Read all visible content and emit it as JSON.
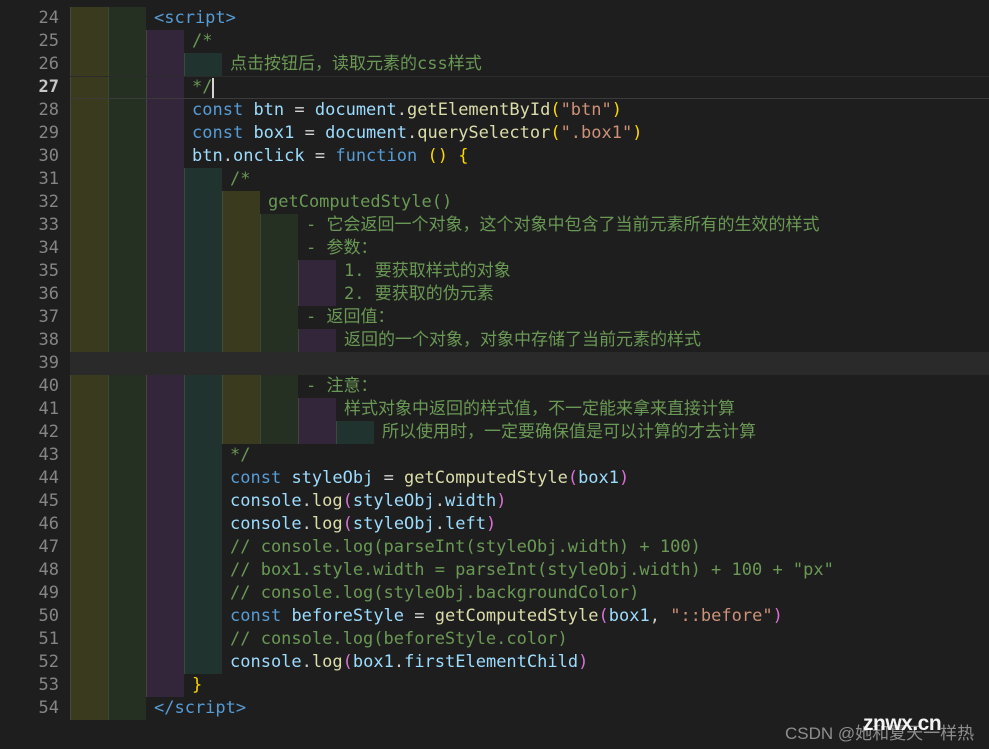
{
  "editor": {
    "first_line": 24,
    "line_height": 23,
    "indent_width": 38,
    "active_line": 27,
    "selected_line": 39,
    "theme": {
      "background": "#1e1e1e",
      "gutter_text": "#858585",
      "gutter_active_text": "#c6c6c6",
      "keyword": "#569cd6",
      "variable": "#9cdcfe",
      "function": "#dcdcaa",
      "string": "#ce9178",
      "number": "#b5cea8",
      "comment": "#6a9955",
      "operator": "#d4d4d4",
      "bracket_yellow": "#ffd700",
      "bracket_magenta": "#da70d6",
      "bracket_blue": "#179fff",
      "indent_olive": "#3a3a1e",
      "indent_green": "#253023",
      "indent_purple": "#33253a",
      "indent_teal": "#21332f"
    }
  },
  "lines": [
    {
      "n": 24,
      "indents": 2,
      "text": "<script>"
    },
    {
      "n": 25,
      "indents": 3,
      "text": "/*"
    },
    {
      "n": 26,
      "indents": 4,
      "text": "点击按钮后，读取元素的css样式"
    },
    {
      "n": 27,
      "indents": 3,
      "text": "*/"
    },
    {
      "n": 28,
      "indents": 3,
      "text": "const btn = document.getElementById(\"btn\")"
    },
    {
      "n": 29,
      "indents": 3,
      "text": "const box1 = document.querySelector(\".box1\")"
    },
    {
      "n": 30,
      "indents": 3,
      "text": "btn.onclick = function () {"
    },
    {
      "n": 31,
      "indents": 4,
      "text": "/*"
    },
    {
      "n": 32,
      "indents": 5,
      "text": "getComputedStyle()"
    },
    {
      "n": 33,
      "indents": 6,
      "text": "- 它会返回一个对象，这个对象中包含了当前元素所有的生效的样式"
    },
    {
      "n": 34,
      "indents": 6,
      "text": "- 参数："
    },
    {
      "n": 35,
      "indents": 7,
      "text": "1. 要获取样式的对象"
    },
    {
      "n": 36,
      "indents": 7,
      "text": "2. 要获取的伪元素"
    },
    {
      "n": 37,
      "indents": 6,
      "text": "- 返回值："
    },
    {
      "n": 38,
      "indents": 7,
      "text": "返回的一个对象，对象中存储了当前元素的样式"
    },
    {
      "n": 39,
      "indents": 0,
      "text": ""
    },
    {
      "n": 40,
      "indents": 6,
      "text": "- 注意："
    },
    {
      "n": 41,
      "indents": 7,
      "text": "样式对象中返回的样式值，不一定能来拿来直接计算"
    },
    {
      "n": 42,
      "indents": 8,
      "text": "所以使用时，一定要确保值是可以计算的才去计算"
    },
    {
      "n": 43,
      "indents": 4,
      "text": "*/"
    },
    {
      "n": 44,
      "indents": 4,
      "text": "const styleObj = getComputedStyle(box1)"
    },
    {
      "n": 45,
      "indents": 4,
      "text": "console.log(styleObj.width)"
    },
    {
      "n": 46,
      "indents": 4,
      "text": "console.log(styleObj.left)"
    },
    {
      "n": 47,
      "indents": 4,
      "text": "// console.log(parseInt(styleObj.width) + 100)"
    },
    {
      "n": 48,
      "indents": 4,
      "text": "// box1.style.width = parseInt(styleObj.width) + 100 + \"px\""
    },
    {
      "n": 49,
      "indents": 4,
      "text": "// console.log(styleObj.backgroundColor)"
    },
    {
      "n": 50,
      "indents": 4,
      "text": "const beforeStyle = getComputedStyle(box1, \"::before\")"
    },
    {
      "n": 51,
      "indents": 4,
      "text": "// console.log(beforeStyle.color)"
    },
    {
      "n": 52,
      "indents": 4,
      "text": "console.log(box1.firstElementChild)"
    },
    {
      "n": 53,
      "indents": 3,
      "text": "}"
    },
    {
      "n": 54,
      "indents": 2,
      "text": "</script>"
    }
  ],
  "tokens": {
    "24": [
      [
        "tag",
        "<script>"
      ]
    ],
    "25": [
      [
        "cmt",
        "/*"
      ]
    ],
    "26": [
      [
        "cmt",
        "点击按钮后，读取元素的css样式"
      ]
    ],
    "27": [
      [
        "cmt",
        "*/"
      ]
    ],
    "28": [
      [
        "kw",
        "const"
      ],
      [
        "op",
        " "
      ],
      [
        "var",
        "btn"
      ],
      [
        "op",
        " = "
      ],
      [
        "var",
        "document"
      ],
      [
        "punc",
        "."
      ],
      [
        "fn",
        "getElementById"
      ],
      [
        "p0",
        "("
      ],
      [
        "str",
        "\"btn\""
      ],
      [
        "p0",
        ")"
      ]
    ],
    "29": [
      [
        "kw",
        "const"
      ],
      [
        "op",
        " "
      ],
      [
        "var",
        "box1"
      ],
      [
        "op",
        " = "
      ],
      [
        "var",
        "document"
      ],
      [
        "punc",
        "."
      ],
      [
        "fn",
        "querySelector"
      ],
      [
        "p0",
        "("
      ],
      [
        "str",
        "\".box1\""
      ],
      [
        "p0",
        ")"
      ]
    ],
    "30": [
      [
        "var",
        "btn"
      ],
      [
        "punc",
        "."
      ],
      [
        "var",
        "onclick"
      ],
      [
        "op",
        " = "
      ],
      [
        "kw",
        "function"
      ],
      [
        "op",
        " "
      ],
      [
        "p0",
        "()"
      ],
      [
        "op",
        " "
      ],
      [
        "p0",
        "{"
      ]
    ],
    "31": [
      [
        "cmt",
        "/*"
      ]
    ],
    "32": [
      [
        "cmt",
        "getComputedStyle()"
      ]
    ],
    "33": [
      [
        "cmt",
        "- 它会返回一个对象，这个对象中包含了当前元素所有的生效的样式"
      ]
    ],
    "34": [
      [
        "cmt",
        "- 参数："
      ]
    ],
    "35": [
      [
        "cmt",
        "1. 要获取样式的对象"
      ]
    ],
    "36": [
      [
        "cmt",
        "2. 要获取的伪元素"
      ]
    ],
    "37": [
      [
        "cmt",
        "- 返回值："
      ]
    ],
    "38": [
      [
        "cmt",
        "返回的一个对象，对象中存储了当前元素的样式"
      ]
    ],
    "39": [],
    "40": [
      [
        "cmt",
        "- 注意："
      ]
    ],
    "41": [
      [
        "cmt",
        "样式对象中返回的样式值，不一定能来拿来直接计算"
      ]
    ],
    "42": [
      [
        "cmt",
        "所以使用时，一定要确保值是可以计算的才去计算"
      ]
    ],
    "43": [
      [
        "cmt",
        "*/"
      ]
    ],
    "44": [
      [
        "kw",
        "const"
      ],
      [
        "op",
        " "
      ],
      [
        "var",
        "styleObj"
      ],
      [
        "op",
        " = "
      ],
      [
        "fn",
        "getComputedStyle"
      ],
      [
        "p1",
        "("
      ],
      [
        "var",
        "box1"
      ],
      [
        "p1",
        ")"
      ]
    ],
    "45": [
      [
        "var",
        "console"
      ],
      [
        "punc",
        "."
      ],
      [
        "fn",
        "log"
      ],
      [
        "p1",
        "("
      ],
      [
        "var",
        "styleObj"
      ],
      [
        "punc",
        "."
      ],
      [
        "var",
        "width"
      ],
      [
        "p1",
        ")"
      ]
    ],
    "46": [
      [
        "var",
        "console"
      ],
      [
        "punc",
        "."
      ],
      [
        "fn",
        "log"
      ],
      [
        "p1",
        "("
      ],
      [
        "var",
        "styleObj"
      ],
      [
        "punc",
        "."
      ],
      [
        "var",
        "left"
      ],
      [
        "p1",
        ")"
      ]
    ],
    "47": [
      [
        "cmt",
        "// console.log(parseInt(styleObj.width) + 100)"
      ]
    ],
    "48": [
      [
        "cmt",
        "// box1.style.width = parseInt(styleObj.width) + 100 + \"px\""
      ]
    ],
    "49": [
      [
        "cmt",
        "// console.log(styleObj.backgroundColor)"
      ]
    ],
    "50": [
      [
        "kw",
        "const"
      ],
      [
        "op",
        " "
      ],
      [
        "var",
        "beforeStyle"
      ],
      [
        "op",
        " = "
      ],
      [
        "fn",
        "getComputedStyle"
      ],
      [
        "p1",
        "("
      ],
      [
        "var",
        "box1"
      ],
      [
        "punc",
        ", "
      ],
      [
        "str",
        "\"::before\""
      ],
      [
        "p1",
        ")"
      ]
    ],
    "51": [
      [
        "cmt",
        "// console.log(beforeStyle.color)"
      ]
    ],
    "52": [
      [
        "var",
        "console"
      ],
      [
        "punc",
        "."
      ],
      [
        "fn",
        "log"
      ],
      [
        "p1",
        "("
      ],
      [
        "var",
        "box1"
      ],
      [
        "punc",
        "."
      ],
      [
        "var",
        "firstElementChild"
      ],
      [
        "p1",
        ")"
      ]
    ],
    "53": [
      [
        "p0",
        "}"
      ]
    ],
    "54": [
      [
        "tag",
        "</script>"
      ]
    ]
  },
  "watermark": {
    "credit": "CSDN @她和夏天一样热",
    "overlay": "znwx.cn"
  }
}
